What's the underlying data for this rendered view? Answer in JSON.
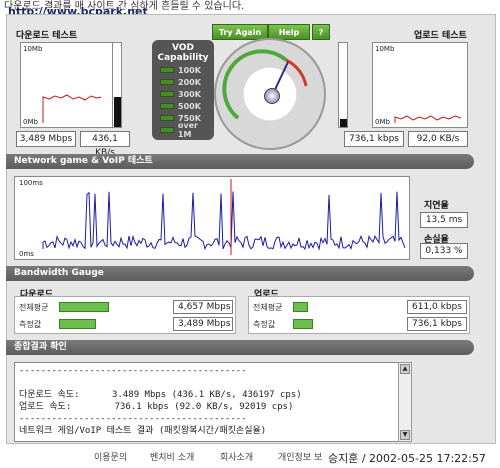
{
  "banner": {
    "text": "다운로드 결과를 매 사이트 간 심하게 흔들릴 수 있습니다.",
    "url": "http://www.bcpark.net"
  },
  "download": {
    "title": "다운로드 테스트",
    "ymax": "10Mb",
    "ymin": "0Mb",
    "mbps": "3,489 Mbps",
    "kbs": "436,1 KB/s"
  },
  "upload": {
    "title": "업로드 테스트",
    "ymax": "10Mb",
    "ymin": "0Mb",
    "kbps": "736,1 kbps",
    "kbs": "92,0 KB/s"
  },
  "vod": {
    "title": "VOD Capability",
    "levels": [
      "100K",
      "200K",
      "300K",
      "500K",
      "750K",
      "over 1M"
    ]
  },
  "buttons": {
    "try_again": "Try Again",
    "help": "Help",
    "question": "?"
  },
  "network": {
    "title": "Network game & VoIP 테스트",
    "ymax": "100ms",
    "ymin": "0ms",
    "latency_label": "지연율",
    "latency": "13,5 ms",
    "loss_label": "손실율",
    "loss": "0,133 %"
  },
  "bandwidth": {
    "title": "Bandwidth Gauge",
    "down": {
      "title": "다운로드",
      "avg_label": "전체평균",
      "avg": "4,657 Mbps",
      "avg_frac": 0.45,
      "meas_label": "측정값",
      "meas": "3,489 Mbps",
      "meas_frac": 0.34
    },
    "up": {
      "title": "업로드",
      "avg_label": "전체평균",
      "avg": "611,0 kbps",
      "avg_frac": 0.14,
      "meas_label": "측정값",
      "meas": "736,1 kbps",
      "meas_frac": 0.18
    }
  },
  "result": {
    "title": "종합결과 확인",
    "lines": "------------------------------------------\n\n다운로드 속도:      3.489 Mbps (436.1 KB/s, 436197 cps)\n업로드 속도:        736.1 kbps (92.0 KB/s, 92019 cps)\n------------------------------------------\n네트워크 게임/VoIP 테스트 결과 (패킷왕복시간/패킷손실율)\n------------------------------------------"
  },
  "footer": {
    "links": [
      "이용문의",
      "벤치비 소개",
      "회사소개",
      "개인정보 보"
    ],
    "stamp": "승지훈 / 2002-05-25 17:22:57"
  }
}
